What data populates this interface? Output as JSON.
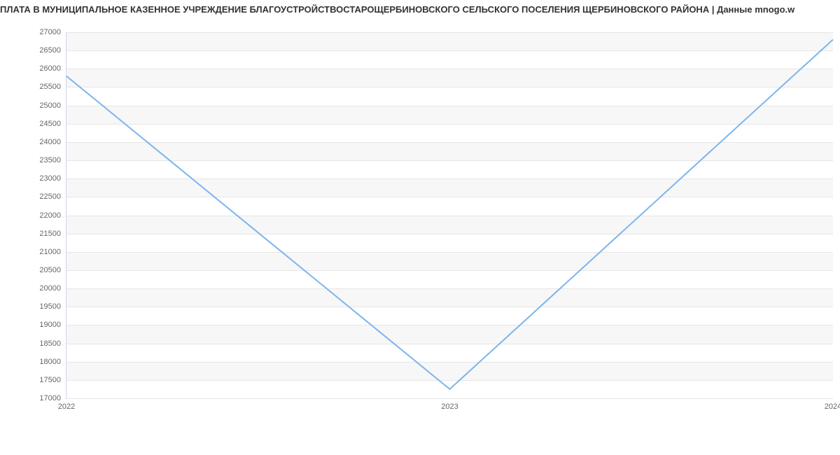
{
  "title": "ПЛАТА В МУНИЦИПАЛЬНОЕ КАЗЕННОЕ УЧРЕЖДЕНИЕ БЛАГОУСТРОЙСТВОСТАРОЩЕРБИНОВСКОГО СЕЛЬСКОГО ПОСЕЛЕНИЯ ЩЕРБИНОВСКОГО РАЙОНА | Данные mnogo.w",
  "chart_data": {
    "type": "line",
    "categories": [
      "2022",
      "2023",
      "2024"
    ],
    "values": [
      25800,
      17250,
      26800
    ],
    "title": "ПЛАТА В МУНИЦИПАЛЬНОЕ КАЗЕННОЕ УЧРЕЖДЕНИЕ БЛАГОУСТРОЙСТВОСТАРОЩЕРБИНОВСКОГО СЕЛЬСКОГО ПОСЕЛЕНИЯ ЩЕРБИНОВСКОГО РАЙОНА | Данные mnogo.w",
    "xlabel": "",
    "ylabel": "",
    "ylim": [
      17000,
      27000
    ],
    "y_ticks": [
      17000,
      17500,
      18000,
      18500,
      19000,
      19500,
      20000,
      20500,
      21000,
      21500,
      22000,
      22500,
      23000,
      23500,
      24000,
      24500,
      25000,
      25500,
      26000,
      26500,
      27000
    ],
    "x_ticks": [
      "2022",
      "2023",
      "2024"
    ]
  }
}
